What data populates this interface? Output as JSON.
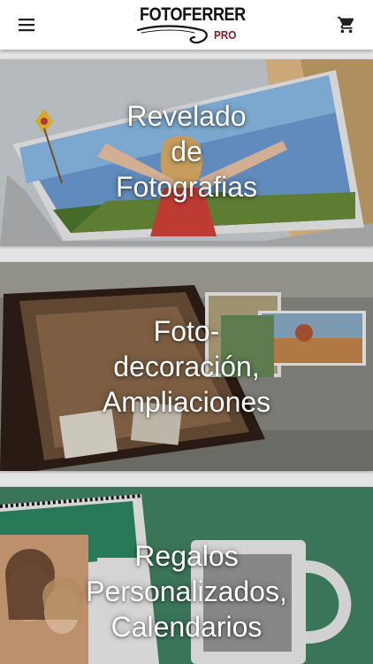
{
  "header": {
    "logo_text": "FOTOFERRER",
    "logo_suffix": "PRO",
    "menu_icon": "hamburger-menu-icon",
    "cart_icon": "shopping-cart-icon"
  },
  "categories": [
    {
      "lines": [
        "Revelado",
        "de",
        "Fotografias"
      ]
    },
    {
      "lines": [
        "Foto-",
        "decoración,",
        "Ampliaciones"
      ]
    },
    {
      "lines": [
        "Regalos",
        "Personalizados,",
        "Calendarios"
      ]
    }
  ],
  "colors": {
    "topbar": "#ffffff",
    "icon": "#212121",
    "logo_accent": "#8b1a2c",
    "card_text": "#ffffff",
    "background": "#e4e4e4"
  }
}
